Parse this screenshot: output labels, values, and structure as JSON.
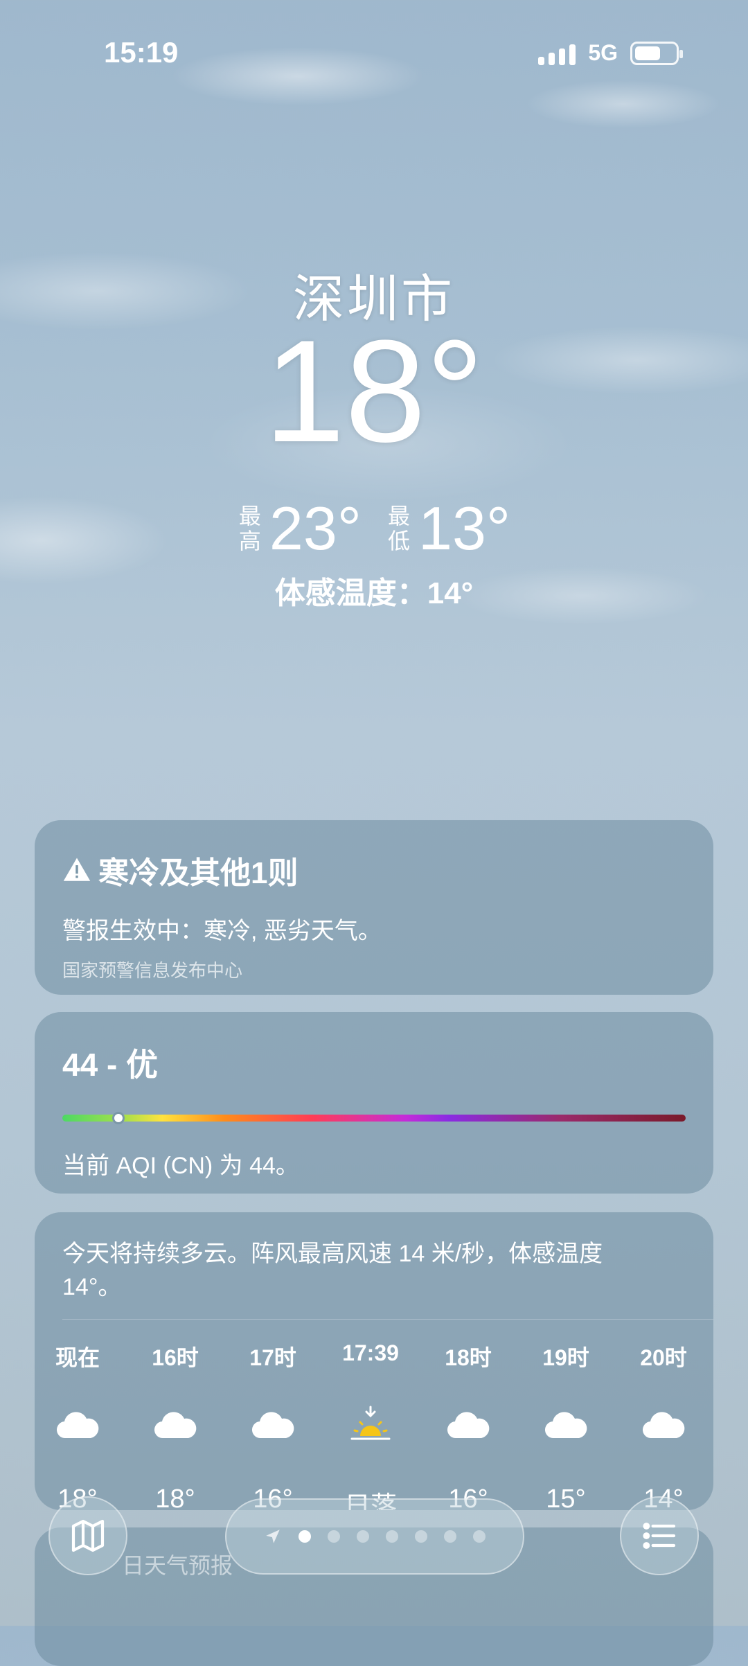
{
  "status": {
    "time": "15:19",
    "network": "5G"
  },
  "header": {
    "city": "深圳市",
    "temperature": "18°",
    "high_label": "最高",
    "high": "23°",
    "low_label": "最低",
    "low": "13°",
    "feels_like": "体感温度：14°"
  },
  "alert": {
    "title": "寒冷及其他1则",
    "body": "警报生效中：寒冷, 恶劣天气。",
    "source": "国家预警信息发布中心"
  },
  "aqi": {
    "title": "44 - 优",
    "value": 44,
    "scale_fraction": 0.09,
    "description": "当前 AQI (CN) 为 44。"
  },
  "hourly": {
    "summary": "今天将持续多云。阵风最高风速 14 米/秒，体感温度 14°。",
    "hours": [
      {
        "time": "现在",
        "icon": "cloud-icon",
        "value": "18°"
      },
      {
        "time": "16时",
        "icon": "cloud-icon",
        "value": "18°"
      },
      {
        "time": "17时",
        "icon": "cloud-icon",
        "value": "16°"
      },
      {
        "time": "17:39",
        "icon": "sunset-icon",
        "value": "日落"
      },
      {
        "time": "18时",
        "icon": "cloud-icon",
        "value": "16°"
      },
      {
        "time": "19时",
        "icon": "cloud-icon",
        "value": "15°"
      },
      {
        "time": "20时",
        "icon": "cloud-icon",
        "value": "14°"
      }
    ]
  },
  "next_card": {
    "label": "日天气预报"
  },
  "pager": {
    "pages": 7,
    "active": 0
  },
  "colors": {
    "card": "#6e8ca0",
    "sun": "#f5c518"
  }
}
